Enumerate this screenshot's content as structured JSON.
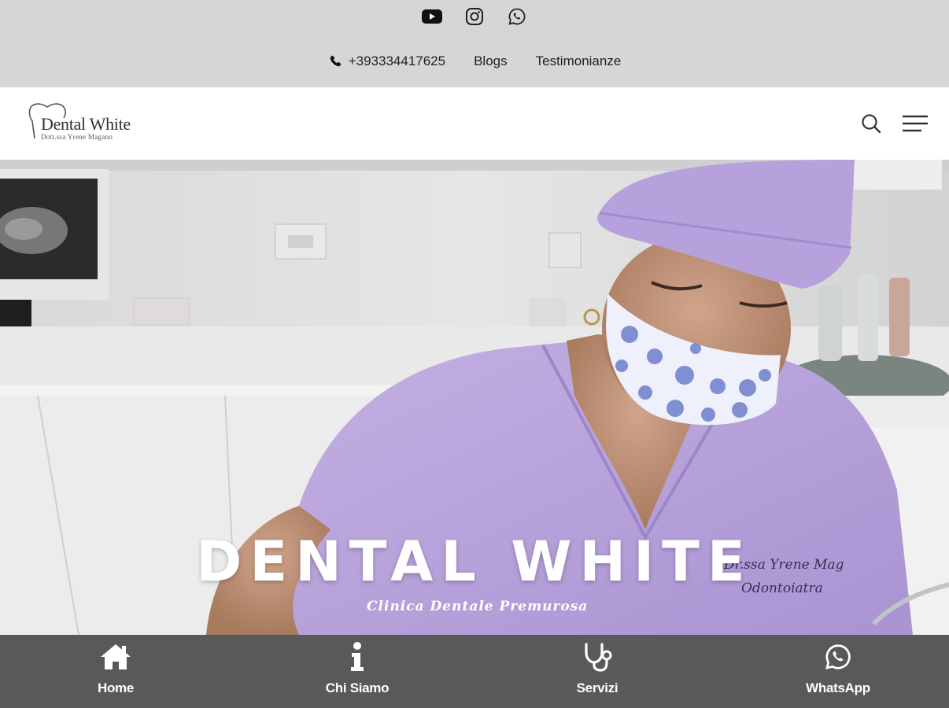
{
  "topbar": {
    "social": [
      {
        "icon": "youtube-icon"
      },
      {
        "icon": "instagram-icon"
      },
      {
        "icon": "whatsapp-icon"
      }
    ],
    "phone": "+393334417625",
    "links": [
      "Blogs",
      "Testimonianze"
    ]
  },
  "header": {
    "logo_name": "Dental White",
    "logo_sub": "Dott.ssa Yrene Magano",
    "search_icon": "search-icon",
    "menu_icon": "hamburger-menu-icon"
  },
  "hero": {
    "title": "DENTAL WHITE",
    "subtitle": "Clinica Dentale Premurosa",
    "embroidery_line1": "Dr.ssa Yrene Mag",
    "embroidery_line2": "Odontoiatra"
  },
  "bottom_nav": [
    {
      "label": "Home",
      "icon": "home-icon"
    },
    {
      "label": "Chi Siamo",
      "icon": "info-icon"
    },
    {
      "label": "Servizi",
      "icon": "stethoscope-icon"
    },
    {
      "label": "WhatsApp",
      "icon": "whatsapp-icon"
    }
  ],
  "colors": {
    "topbar_bg": "#d6d6d6",
    "bottom_nav_bg": "#595959",
    "scrubs": "#b8a3d8"
  }
}
